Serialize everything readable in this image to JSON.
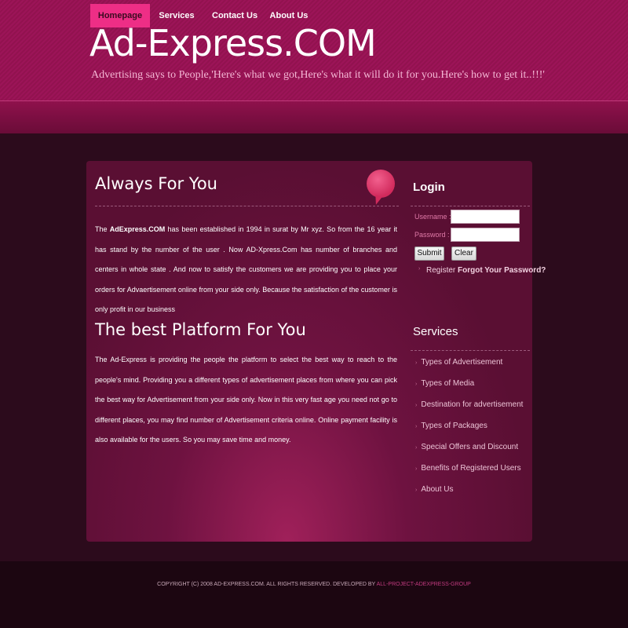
{
  "header": {
    "title": "Ad-Express.COM",
    "tagline": "Advertising says to People,'Here's what we got,Here's what it will do it for you.Here's how to get it..!!!'"
  },
  "nav": {
    "items": [
      "Homepage",
      "Services",
      "Contact Us",
      "About Us"
    ],
    "active": "Homepage"
  },
  "main": {
    "section1": {
      "heading": "Always For You",
      "para_prefix": "The ",
      "para_brand": "AdExpress.COM",
      "para_rest": " has been established in 1994 in surat by Mr xyz. So from the 16 year it has stand by the number of the user . Now AD-Xpress.Com has number of branches and centers in whole state . And now to satisfy the customers we are providing you to place your orders for Advaertisement online from your side only. Because the satisfaction of the customer is only profit in our business"
    },
    "section2": {
      "heading": "The best Platform For You",
      "paragraph": "The Ad-Express is providing the people the platform to select the best way to reach to the people's mind. Providing you a different types of advertisement places from where you can pick the best way for Advertisement from your side only. Now in this very fast age you need not go to different places, you may find number of Advertisement criteria online. Online payment facility is also available for the users. So you may save time and money."
    }
  },
  "login": {
    "title": "Login",
    "username_label": "Username :",
    "password_label": "Password :",
    "username_value": "",
    "password_value": "",
    "submit_label": "Submit",
    "clear_label": "Clear",
    "register_label": "Register",
    "forgot_label": "Forgot Your Password?"
  },
  "services": {
    "title": "Services",
    "items": [
      "Types of Advertisement",
      "Types of Media",
      "Destination for advertisement",
      "Types of Packages",
      "Special Offers and Discount",
      "Benefits of Registered Users",
      "About Us"
    ]
  },
  "footer": {
    "copyright": "COPYRIGHT (C) 2008 AD-EXPRESS.COM. ALL RIGHTS RESERVED. DEVELOPED BY ",
    "developer": "ALL-PROJECT-ADEXPRESS-GROUP"
  },
  "colors": {
    "header": "#96134f",
    "nav_active": "#ee2e86",
    "background": "#2c0b1c",
    "footer": "#1c0611"
  },
  "icons": {
    "bubble": "speech-bubble-icon",
    "bullet": "arrow-bullet-icon"
  }
}
